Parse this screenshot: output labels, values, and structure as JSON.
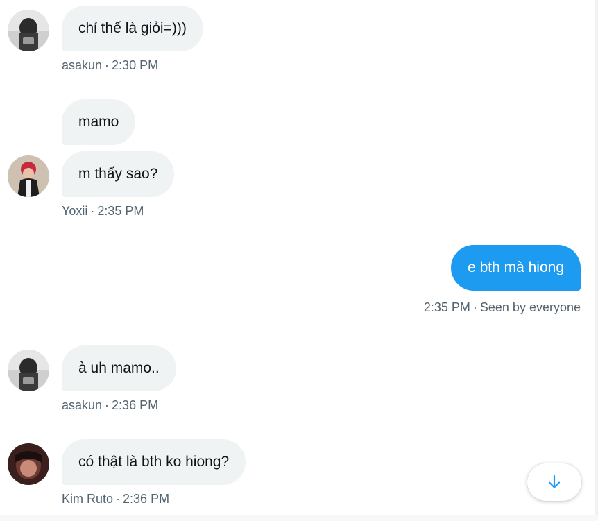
{
  "messages": [
    {
      "text": "chỉ thế là giỏi=)))",
      "author": "asakun",
      "time": "2:30 PM"
    },
    {
      "text": "mamo"
    },
    {
      "text": "m thấy sao?",
      "author": "Yoxii",
      "time": "2:35 PM"
    },
    {
      "text": "e bth mà hiong",
      "time": "2:35 PM",
      "status": "Seen by everyone"
    },
    {
      "text": "à uh mamo..",
      "author": "asakun",
      "time": "2:36 PM"
    },
    {
      "text": "có thật là bth ko hiong?",
      "author": "Kim Ruto",
      "time": "2:36 PM"
    }
  ],
  "separator": "·",
  "colors": {
    "accent": "#1d9bf0",
    "incoming_bubble": "#eff3f4",
    "meta_text": "#536471"
  },
  "icons": {
    "scroll_down": "arrow-down-icon"
  }
}
